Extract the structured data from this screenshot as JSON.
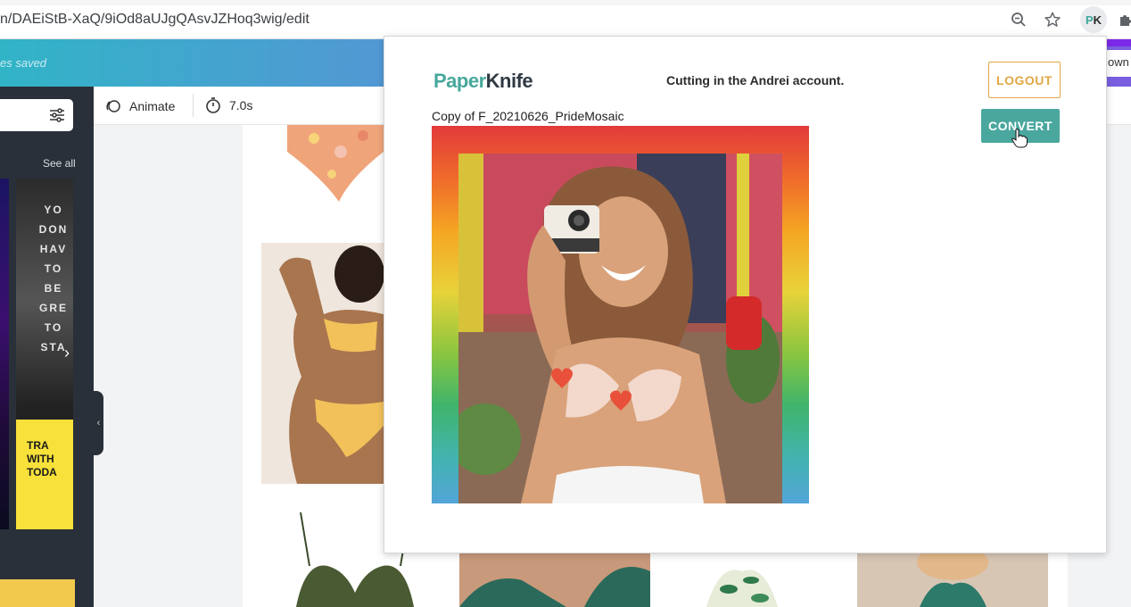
{
  "browser": {
    "url": "n/DAEiStB-XaQ/9iOd8aUJgQAsvJZHoq3wig/edit",
    "extension_badge": {
      "p": "P",
      "k": "K"
    },
    "icons": [
      "zoom-icon",
      "star-icon",
      "paperknife-extension-icon",
      "puzzle-icon"
    ]
  },
  "canva": {
    "saved_status": "es saved",
    "download_label": "own",
    "brand_gradient": [
      "#31b4c7",
      "#5d8fd8",
      "#7a5ee0"
    ],
    "sidebar": {
      "see_all": "See all",
      "poster_text": "YO DON HAV TO BE GRE TO STA",
      "poster_yellow_text": "TRA WITH TODA"
    },
    "toolbar": {
      "animate_label": "Animate",
      "duration_label": "7.0s"
    }
  },
  "popup": {
    "logo_part1": "Paper",
    "logo_part2": "Knife",
    "account_message": "Cutting in the Andrei account.",
    "logout_label": "LOGOUT",
    "convert_label": "CONVERT",
    "design_name": "Copy of F_20210626_PrideMosaic",
    "accent_teal": "#4aa79e",
    "accent_orange": "#e1a744"
  }
}
